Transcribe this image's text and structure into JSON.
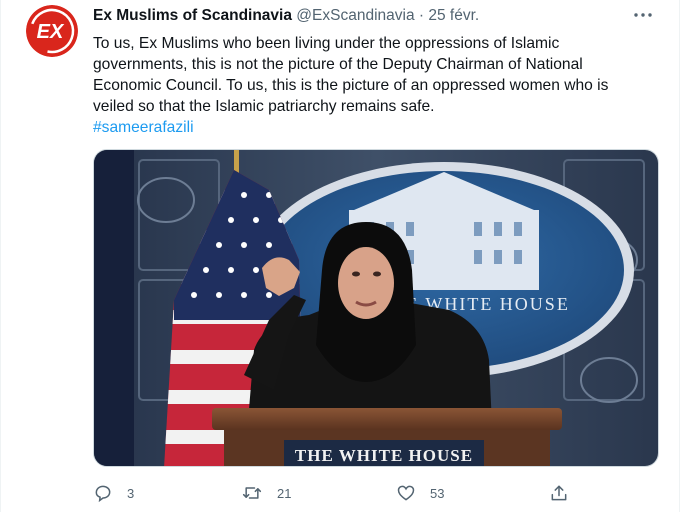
{
  "tweet": {
    "avatar_text": "EX",
    "author_name": "Ex Muslims of Scandinavia",
    "author_handle": "@ExScandinavia",
    "separator": "·",
    "date": "25 févr.",
    "text": "To us, Ex Muslims who been living under the oppressions of Islamic governments, this is not the picture of the Deputy Chairman of National Economic Council. To us, this is the picture of an oppressed women who is veiled so that the Islamic patriarchy remains safe.",
    "hashtag": "#sameerafazili"
  },
  "photo": {
    "seal_text": "THE WHITE HOUSE",
    "podium_text": "THE WHITE HOUSE"
  },
  "actions": {
    "reply_count": "3",
    "retweet_count": "21",
    "like_count": "53"
  },
  "icons": {
    "more": "more-dots-icon",
    "reply": "reply-bubble-icon",
    "retweet": "retweet-arrows-icon",
    "like": "heart-icon",
    "share": "share-upload-icon"
  },
  "colors": {
    "link": "#1d9bf0",
    "secondary_text": "#536471",
    "avatar_red": "#d9261c"
  }
}
